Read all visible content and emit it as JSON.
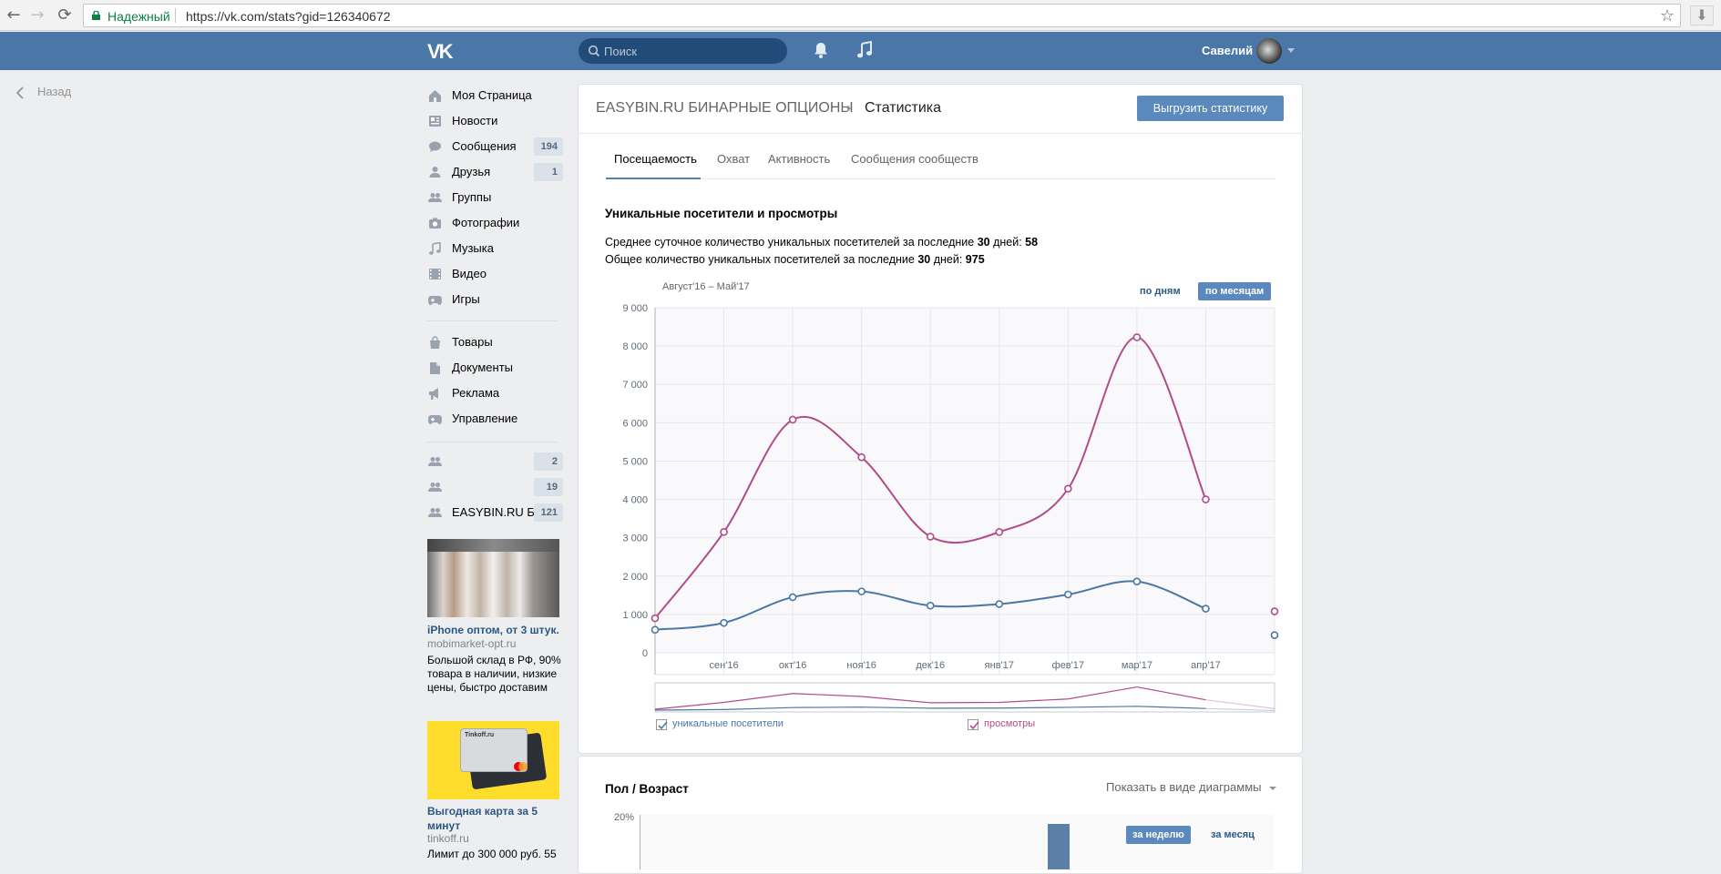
{
  "browser": {
    "secure_label": "Надежный",
    "url": "https://vk.com/stats?gid=126340672",
    "back_glyph": "←",
    "forward_glyph": "→",
    "reload_glyph": "⟳",
    "star_glyph": "☆",
    "ext_glyph": "⬇"
  },
  "header": {
    "logo": "VK",
    "search_placeholder": "Поиск",
    "user_name": "Савелий",
    "accent": "#4a76a8"
  },
  "back_link": "Назад",
  "menu": [
    {
      "label": "Моя Страница",
      "icon": "home-icon",
      "badge": ""
    },
    {
      "label": "Новости",
      "icon": "news-icon",
      "badge": ""
    },
    {
      "label": "Сообщения",
      "icon": "messages-icon",
      "badge": "194"
    },
    {
      "label": "Друзья",
      "icon": "friends-icon",
      "badge": "1"
    },
    {
      "label": "Группы",
      "icon": "groups-icon",
      "badge": ""
    },
    {
      "label": "Фотографии",
      "icon": "photo-icon",
      "badge": ""
    },
    {
      "label": "Музыка",
      "icon": "music-icon",
      "badge": ""
    },
    {
      "label": "Видео",
      "icon": "video-icon",
      "badge": ""
    },
    {
      "label": "Игры",
      "icon": "games-icon",
      "badge": ""
    }
  ],
  "menu2": [
    {
      "label": "Товары",
      "icon": "market-icon",
      "badge": ""
    },
    {
      "label": "Документы",
      "icon": "docs-icon",
      "badge": ""
    },
    {
      "label": "Реклама",
      "icon": "ads-icon",
      "badge": ""
    },
    {
      "label": "Управление",
      "icon": "manage-icon",
      "badge": ""
    }
  ],
  "menu3": [
    {
      "label": "",
      "icon": "community-icon",
      "badge": "2"
    },
    {
      "label": "",
      "icon": "community-icon",
      "badge": "19"
    },
    {
      "label": "EASYBIN.RU Б...",
      "icon": "community-icon",
      "badge": "121"
    }
  ],
  "ads": [
    {
      "title": "iPhone оптом, от 3 штук.",
      "domain": "mobimarket-opt.ru",
      "text": "Большой склад в РФ, 90% товара в наличии, низкие цены, быстро доставим"
    },
    {
      "title": "Выгодная карта за 5 минут",
      "domain": "tinkoff.ru",
      "text": "Лимит до 300 000 руб. 55",
      "card_brand": "Tinkoff.ru"
    }
  ],
  "page": {
    "group_name": "EASYBIN.RU БИНАРНЫЕ ОПЦИОНЫ",
    "separator": "›",
    "title": "Статистика",
    "export_button": "Выгрузить статистику"
  },
  "tabs": [
    "Посещаемость",
    "Охват",
    "Активность",
    "Сообщения сообществ"
  ],
  "section1": {
    "title": "Уникальные посетители и просмотры",
    "line1_prefix": "Среднее суточное количество уникальных посетителей за последние ",
    "line1_days": "30",
    "line1_mid": " дней: ",
    "line1_value": "58",
    "line2_prefix": "Общее количество уникальных посетителей за последние ",
    "line2_days": "30",
    "line2_mid": " дней: ",
    "line2_value": "975",
    "period": "Август'16 – Май'17",
    "btn_days": "по дням",
    "btn_months": "по месяцам"
  },
  "chart_data": {
    "type": "line",
    "x": [
      "авг'16",
      "сен'16",
      "окт'16",
      "ноя'16",
      "дек'16",
      "янв'17",
      "фев'17",
      "мар'17",
      "апр'17",
      "май'17"
    ],
    "x_tick_labels": [
      "",
      "сен'16",
      "окт'16",
      "ноя'16",
      "дек'16",
      "янв'17",
      "фев'17",
      "мар'17",
      "апр'17",
      ""
    ],
    "y_ticks": [
      "0",
      "1 000",
      "2 000",
      "3 000",
      "4 000",
      "5 000",
      "6 000",
      "7 000",
      "8 000",
      "9 000"
    ],
    "ylim": [
      0,
      9000
    ],
    "series": [
      {
        "name": "уникальные посетители",
        "color": "#4b77a3",
        "values": [
          600,
          780,
          1450,
          1600,
          1230,
          1270,
          1520,
          1860,
          1150,
          460
        ]
      },
      {
        "name": "просмотры",
        "color": "#b04c8a",
        "values": [
          900,
          3150,
          6080,
          5100,
          3030,
          3150,
          4280,
          8230,
          4000,
          1080
        ]
      }
    ],
    "grid": true,
    "legend": "bottom"
  },
  "section2": {
    "title": "Пол / Возраст",
    "show_as": "Показать в виде диаграммы",
    "y_top": "20%",
    "btn_week": "за неделю",
    "btn_month": "за месяц",
    "bar_color": "#5b7fa6"
  }
}
